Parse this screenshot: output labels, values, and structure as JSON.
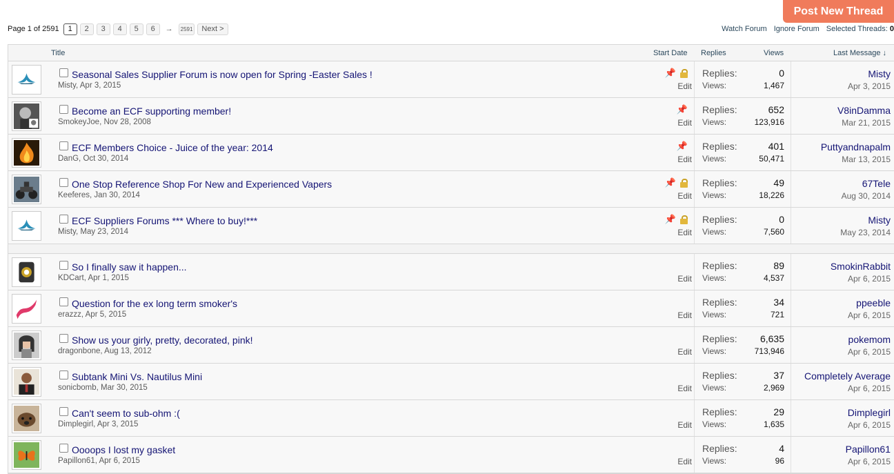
{
  "post_button": "Post New Thread",
  "pagenav": {
    "label": "Page 1 of 2591",
    "pages": [
      "1",
      "2",
      "3",
      "4",
      "5",
      "6"
    ],
    "arrow": "→",
    "last": "2591",
    "next": "Next >"
  },
  "forum_actions": {
    "watch": "Watch Forum",
    "ignore": "Ignore Forum",
    "selected_label": "Selected Threads:",
    "selected_count": "0"
  },
  "columns": {
    "title": "Title",
    "start_date": "Start Date",
    "replies": "Replies",
    "views": "Views",
    "last_message": "Last Message ↓"
  },
  "labels": {
    "replies": "Replies:",
    "views": "Views:",
    "edit": "Edit"
  },
  "sticky_threads": [
    {
      "title": "Seasonal Sales Supplier Forum is now open for Spring -Easter Sales !",
      "author": "Misty",
      "date": "Apr 3, 2015",
      "replies": "0",
      "views": "1,467",
      "last_user": "Misty",
      "last_date": "Apr 3, 2015",
      "pinned": true,
      "locked": true,
      "avatar": "lotus"
    },
    {
      "title": "Become an ECF supporting member!",
      "author": "SmokeyJoe",
      "date": "Nov 28, 2008",
      "replies": "652",
      "views": "123,916",
      "last_user": "V8inDamma",
      "last_date": "Mar 21, 2015",
      "pinned": true,
      "locked": false,
      "avatar": "bw-face"
    },
    {
      "title": "ECF Members Choice - Juice of the year: 2014",
      "author": "DanG",
      "date": "Oct 30, 2014",
      "replies": "401",
      "views": "50,471",
      "last_user": "Puttyandnapalm",
      "last_date": "Mar 13, 2015",
      "pinned": true,
      "locked": false,
      "avatar": "fire"
    },
    {
      "title": "One Stop Reference Shop For New and Experienced Vapers",
      "author": "Keeferes",
      "date": "Jan 30, 2014",
      "replies": "49",
      "views": "18,226",
      "last_user": "67Tele",
      "last_date": "Aug 30, 2014",
      "pinned": true,
      "locked": true,
      "avatar": "motorcycle"
    },
    {
      "title": "ECF Suppliers Forums *** Where to buy!***",
      "author": "Misty",
      "date": "May 23, 2014",
      "replies": "0",
      "views": "7,560",
      "last_user": "Misty",
      "last_date": "May 23, 2014",
      "pinned": true,
      "locked": true,
      "avatar": "lotus"
    }
  ],
  "threads": [
    {
      "title": "So I finally saw it happen...",
      "author": "KDCart",
      "date": "Apr 1, 2015",
      "replies": "89",
      "views": "4,537",
      "last_user": "SmokinRabbit",
      "last_date": "Apr 6, 2015",
      "avatar": "device"
    },
    {
      "title": "Question for the ex long term smoker's",
      "author": "erazzz",
      "date": "Apr 5, 2015",
      "replies": "34",
      "views": "721",
      "last_user": "ppeeble",
      "last_date": "Apr 6, 2015",
      "avatar": "pink"
    },
    {
      "title": "Show us your girly, pretty, decorated, pink!",
      "author": "dragonbone",
      "date": "Aug 13, 2012",
      "replies": "6,635",
      "views": "713,946",
      "last_user": "pokemom",
      "last_date": "Apr 6, 2015",
      "avatar": "girl"
    },
    {
      "title": "Subtank Mini Vs. Nautilus Mini",
      "author": "sonicbomb",
      "date": "Mar 30, 2015",
      "replies": "37",
      "views": "2,969",
      "last_user": "Completely Average",
      "last_date": "Apr 6, 2015",
      "avatar": "man"
    },
    {
      "title": "Can't seem to sub-ohm :(",
      "author": "Dimplegirl",
      "date": "Apr 3, 2015",
      "replies": "29",
      "views": "1,635",
      "last_user": "Dimplegirl",
      "last_date": "Apr 6, 2015",
      "avatar": "dog"
    },
    {
      "title": "Oooops I lost my gasket",
      "author": "Papillon61",
      "date": "Apr 6, 2015",
      "replies": "4",
      "views": "96",
      "last_user": "Papillon61",
      "last_date": "Apr 6, 2015",
      "avatar": "butterfly"
    }
  ],
  "colors": {
    "accent": "#f07b5b",
    "link": "#141474"
  }
}
